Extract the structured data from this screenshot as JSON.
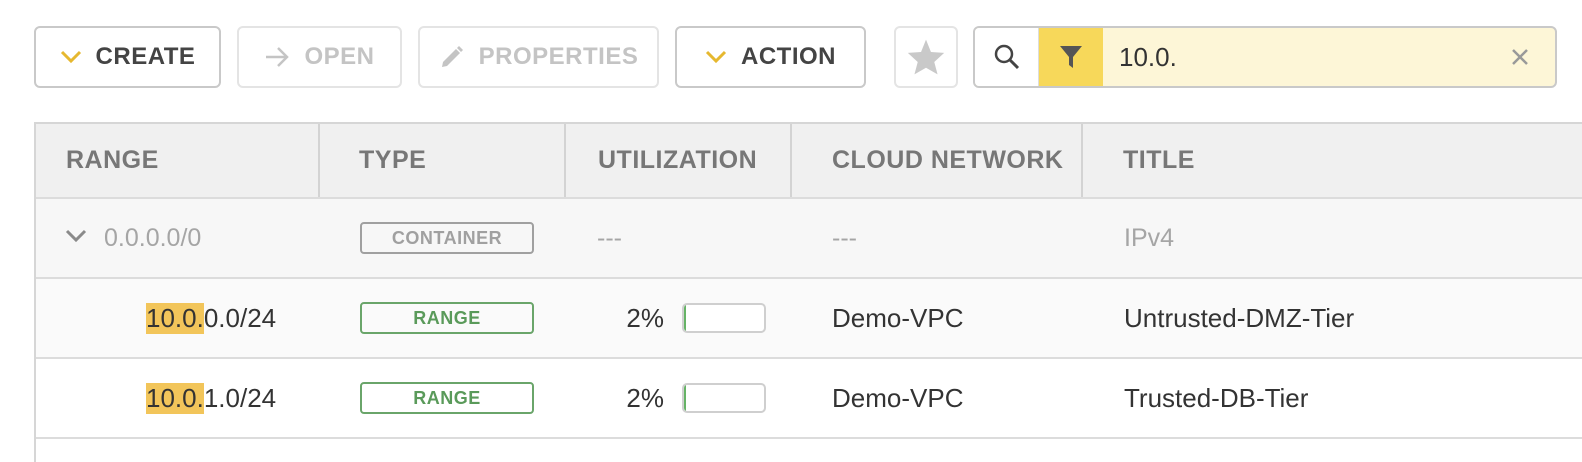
{
  "toolbar": {
    "create_label": "CREATE",
    "open_label": "OPEN",
    "properties_label": "PROPERTIES",
    "action_label": "ACTION"
  },
  "search": {
    "value": "10.0."
  },
  "table": {
    "headers": [
      "RANGE",
      "TYPE",
      "UTILIZATION",
      "CLOUD NETWORK",
      "TITLE"
    ],
    "rows": [
      {
        "range": "0.0.0.0/0",
        "type": "CONTAINER",
        "utilization": "---",
        "cloud_network": "---",
        "title": "IPv4"
      },
      {
        "range_match": "10.0.",
        "range_rest": "0.0/24",
        "type": "RANGE",
        "utilization": "2%",
        "utilization_fraction": 0.02,
        "cloud_network": "Demo-VPC",
        "title": "Untrusted-DMZ-Tier"
      },
      {
        "range_match": "10.0.",
        "range_rest": "1.0/24",
        "type": "RANGE",
        "utilization": "2%",
        "utilization_fraction": 0.02,
        "cloud_network": "Demo-VPC",
        "title": "Trusted-DB-Tier"
      }
    ]
  },
  "colors": {
    "accent": "#f7d85a",
    "highlight": "#f2c55a",
    "range_badge": "#5a9a5a",
    "utilization_fill": "#66b366"
  }
}
